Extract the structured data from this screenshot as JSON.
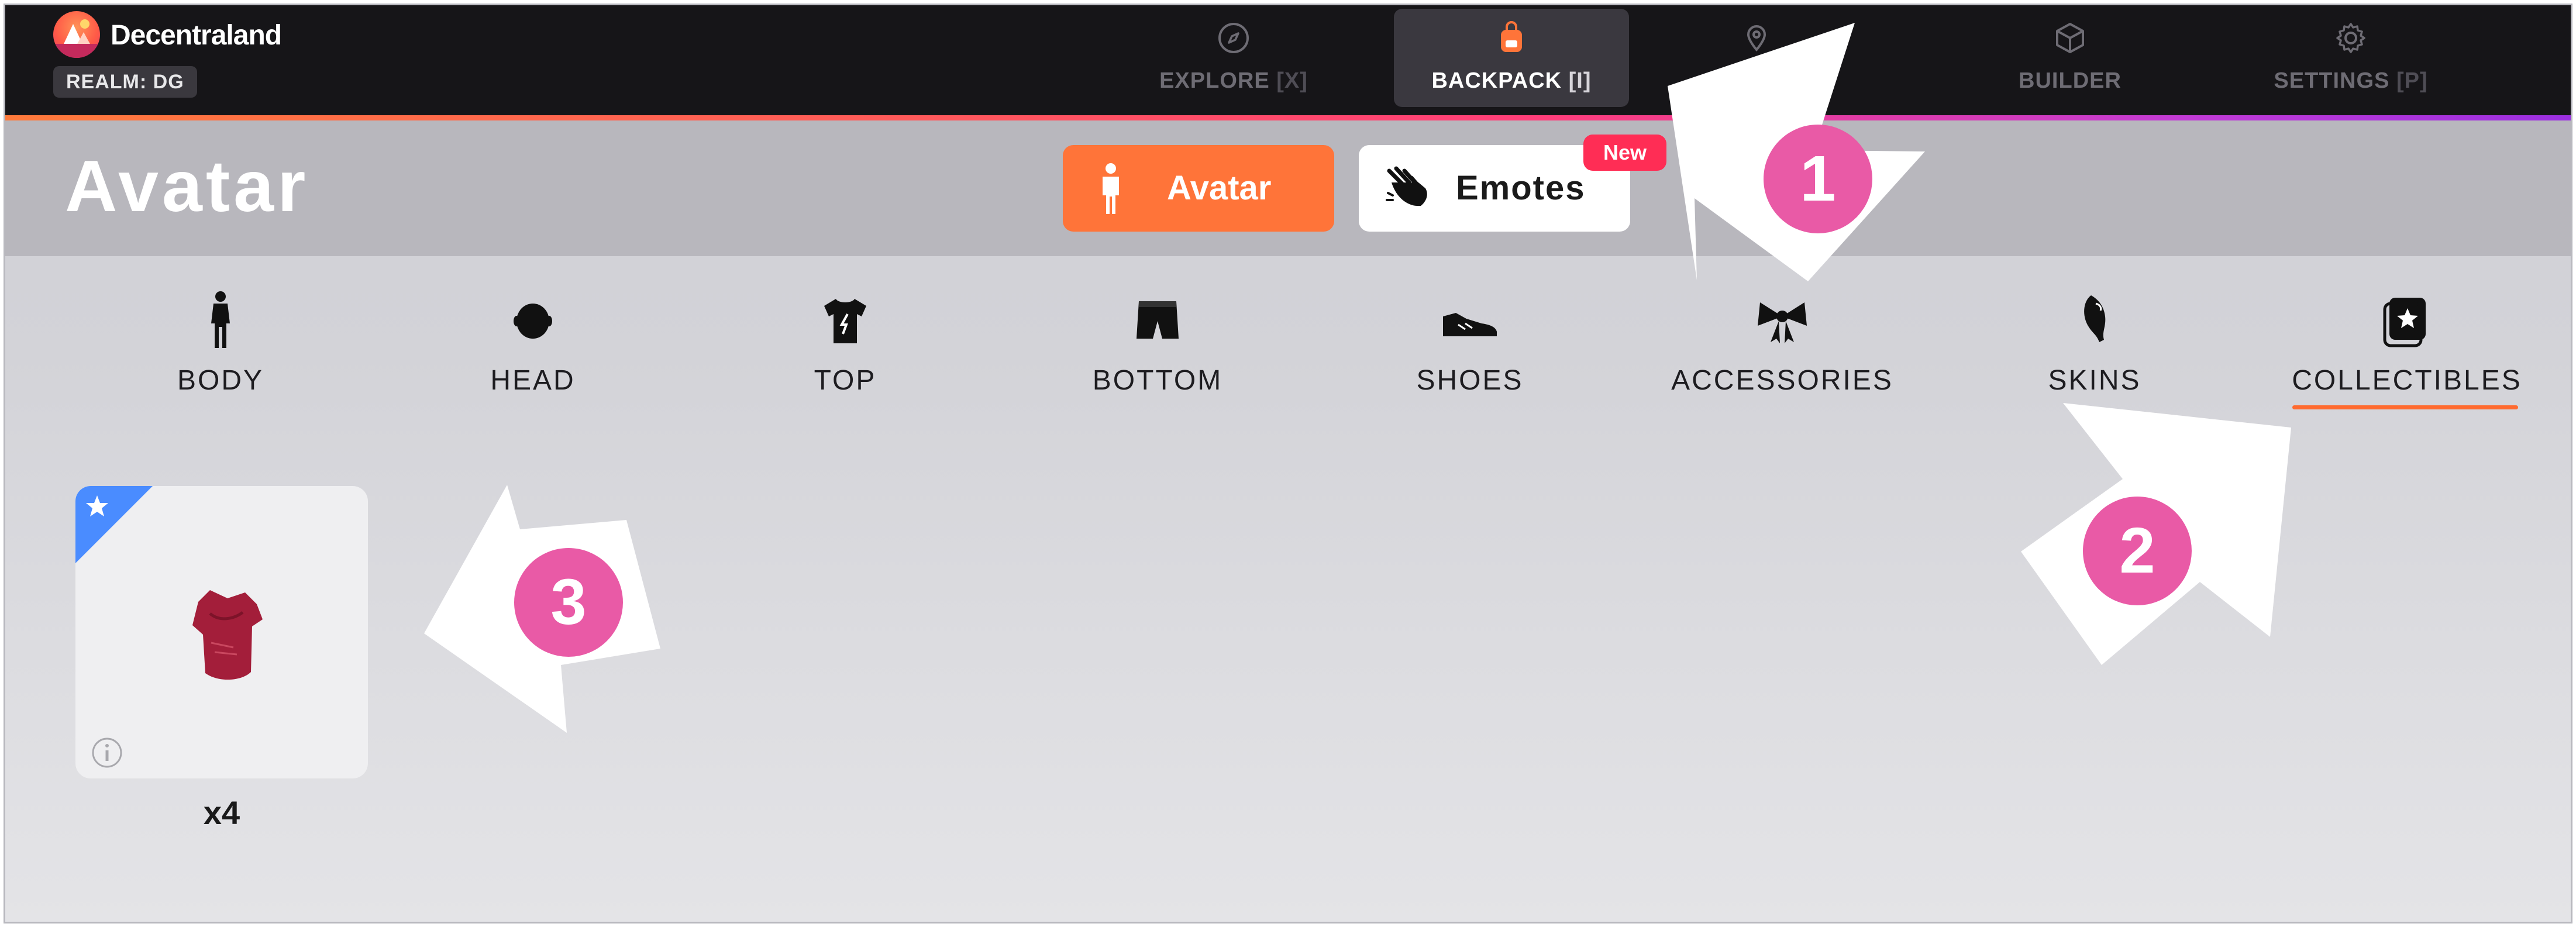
{
  "app": {
    "name": "Decentraland",
    "realm": "REALM: DG"
  },
  "nav": [
    {
      "label": "EXPLORE",
      "key": "[X]",
      "icon": "compass-icon",
      "active": false
    },
    {
      "label": "BACKPACK",
      "key": "[I]",
      "icon": "backpack-icon",
      "active": true
    },
    {
      "label": "",
      "key": "[I]",
      "icon": "map-pin-icon",
      "active": false
    },
    {
      "label": "BUILDER",
      "key": "",
      "icon": "cube-icon",
      "active": false
    },
    {
      "label": "SETTINGS",
      "key": "[P]",
      "icon": "gear-icon",
      "active": false
    }
  ],
  "header": {
    "title": "Avatar",
    "tabs": [
      {
        "label": "Avatar",
        "icon": "person-icon",
        "active": true
      },
      {
        "label": "Emotes",
        "icon": "hand-wave-icon",
        "active": false,
        "badge": "New"
      }
    ]
  },
  "categories": [
    {
      "label": "BODY",
      "icon": "body-icon"
    },
    {
      "label": "HEAD",
      "icon": "head-icon"
    },
    {
      "label": "TOP",
      "icon": "tshirt-icon"
    },
    {
      "label": "BOTTOM",
      "icon": "shorts-icon"
    },
    {
      "label": "SHOES",
      "icon": "shoe-icon"
    },
    {
      "label": "ACCESSORIES",
      "icon": "bow-icon"
    },
    {
      "label": "SKINS",
      "icon": "skin-icon"
    },
    {
      "label": "COLLECTIBLES",
      "icon": "collectible-star-icon",
      "selected": true
    }
  ],
  "items": [
    {
      "icon": "red-shirt-icon",
      "count": "x4",
      "rarity_color": "#4a8cff"
    }
  ],
  "annotations": [
    "1",
    "2",
    "3"
  ],
  "colors": {
    "accent": "#ff7439",
    "topbar": "#161518",
    "badge_new": "#ff2d55",
    "annotation_circle": "#e95aa6",
    "header_band": "#b8b7bd"
  }
}
